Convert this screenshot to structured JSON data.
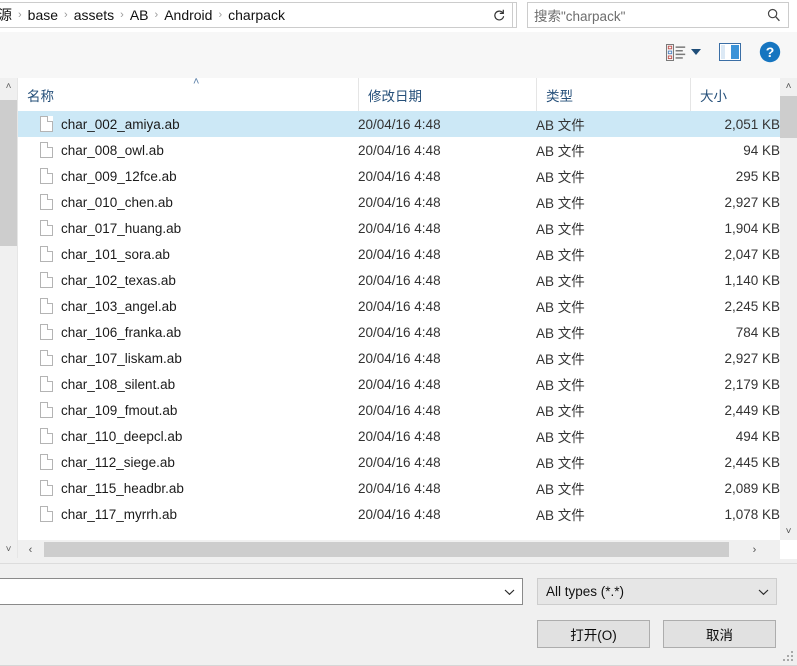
{
  "breadcrumb": {
    "segments": [
      "源",
      "base",
      "assets",
      "AB",
      "Android",
      "charpack"
    ],
    "separator": "›",
    "dropdown_icon": "chevron-down-icon",
    "refresh_icon": "refresh-icon"
  },
  "search": {
    "placeholder": "搜索\"charpack\"",
    "icon": "search-icon"
  },
  "toolbar": {
    "view_icon": "view-list-icon",
    "view_dropdown_icon": "chevron-down-icon",
    "preview_pane_icon": "preview-pane-icon",
    "help_icon": "help-icon",
    "help_label": "?"
  },
  "columns": [
    {
      "key": "name",
      "label": "名称"
    },
    {
      "key": "date",
      "label": "修改日期"
    },
    {
      "key": "type",
      "label": "类型"
    },
    {
      "key": "size",
      "label": "大小"
    }
  ],
  "sort": {
    "column": "name",
    "direction": "asc",
    "marker": "˄"
  },
  "files": [
    {
      "name": "char_002_amiya.ab",
      "date": "20/04/16 4:48",
      "type": "AB 文件",
      "size": "2,051 KB",
      "selected": true
    },
    {
      "name": "char_008_owl.ab",
      "date": "20/04/16 4:48",
      "type": "AB 文件",
      "size": "94 KB",
      "selected": false
    },
    {
      "name": "char_009_12fce.ab",
      "date": "20/04/16 4:48",
      "type": "AB 文件",
      "size": "295 KB",
      "selected": false
    },
    {
      "name": "char_010_chen.ab",
      "date": "20/04/16 4:48",
      "type": "AB 文件",
      "size": "2,927 KB",
      "selected": false
    },
    {
      "name": "char_017_huang.ab",
      "date": "20/04/16 4:48",
      "type": "AB 文件",
      "size": "1,904 KB",
      "selected": false
    },
    {
      "name": "char_101_sora.ab",
      "date": "20/04/16 4:48",
      "type": "AB 文件",
      "size": "2,047 KB",
      "selected": false
    },
    {
      "name": "char_102_texas.ab",
      "date": "20/04/16 4:48",
      "type": "AB 文件",
      "size": "1,140 KB",
      "selected": false
    },
    {
      "name": "char_103_angel.ab",
      "date": "20/04/16 4:48",
      "type": "AB 文件",
      "size": "2,245 KB",
      "selected": false
    },
    {
      "name": "char_106_franka.ab",
      "date": "20/04/16 4:48",
      "type": "AB 文件",
      "size": "784 KB",
      "selected": false
    },
    {
      "name": "char_107_liskam.ab",
      "date": "20/04/16 4:48",
      "type": "AB 文件",
      "size": "2,927 KB",
      "selected": false
    },
    {
      "name": "char_108_silent.ab",
      "date": "20/04/16 4:48",
      "type": "AB 文件",
      "size": "2,179 KB",
      "selected": false
    },
    {
      "name": "char_109_fmout.ab",
      "date": "20/04/16 4:48",
      "type": "AB 文件",
      "size": "2,449 KB",
      "selected": false
    },
    {
      "name": "char_110_deepcl.ab",
      "date": "20/04/16 4:48",
      "type": "AB 文件",
      "size": "494 KB",
      "selected": false
    },
    {
      "name": "char_112_siege.ab",
      "date": "20/04/16 4:48",
      "type": "AB 文件",
      "size": "2,445 KB",
      "selected": false
    },
    {
      "name": "char_115_headbr.ab",
      "date": "20/04/16 4:48",
      "type": "AB 文件",
      "size": "2,089 KB",
      "selected": false
    },
    {
      "name": "char_117_myrrh.ab",
      "date": "20/04/16 4:48",
      "type": "AB 文件",
      "size": "1,078 KB",
      "selected": false
    }
  ],
  "footer": {
    "filename_value": "",
    "filename_placeholder": "",
    "filetype_value": "All types (*.*)",
    "open_label": "打开(O)",
    "cancel_label": "取消",
    "dropdown_icon": "chevron-down-icon"
  },
  "scrollbars": {
    "up_arrow": "˄",
    "down_arrow": "˅",
    "left_arrow": "‹",
    "right_arrow": "›"
  },
  "colors": {
    "selection": "#cce8f6",
    "header_text": "#26507a",
    "accent": "#1f7fd4",
    "scroll_thumb": "#cdcdcd"
  }
}
